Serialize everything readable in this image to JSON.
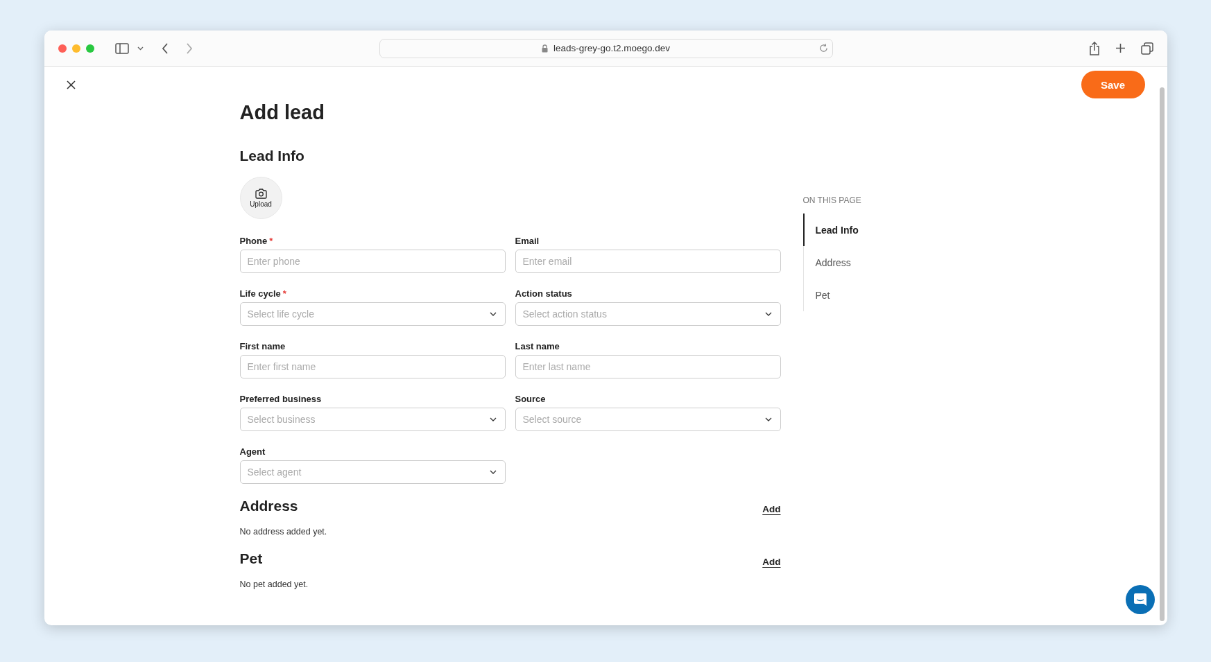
{
  "browser": {
    "url": "leads-grey-go.t2.moego.dev"
  },
  "page": {
    "title": "Add lead",
    "save_label": "Save"
  },
  "lead_info": {
    "heading": "Lead Info",
    "upload_label": "Upload",
    "required_mark": "*",
    "fields": [
      {
        "kind": "input",
        "label": "Phone",
        "required": true,
        "placeholder": "Enter phone"
      },
      {
        "kind": "input",
        "label": "Email",
        "required": false,
        "placeholder": "Enter email"
      },
      {
        "kind": "select",
        "label": "Life cycle",
        "required": true,
        "placeholder": "Select life cycle"
      },
      {
        "kind": "select",
        "label": "Action status",
        "required": false,
        "placeholder": "Select action status"
      },
      {
        "kind": "input",
        "label": "First name",
        "required": false,
        "placeholder": "Enter first name"
      },
      {
        "kind": "input",
        "label": "Last name",
        "required": false,
        "placeholder": "Enter last name"
      },
      {
        "kind": "select",
        "label": "Preferred business",
        "required": false,
        "placeholder": "Select business"
      },
      {
        "kind": "select",
        "label": "Source",
        "required": false,
        "placeholder": "Select source"
      },
      {
        "kind": "select",
        "label": "Agent",
        "required": false,
        "placeholder": "Select agent"
      }
    ]
  },
  "sections": [
    {
      "heading": "Address",
      "action": "Add",
      "empty_text": "No address added yet."
    },
    {
      "heading": "Pet",
      "action": "Add",
      "empty_text": "No pet added yet."
    }
  ],
  "toc": {
    "heading": "ON THIS PAGE",
    "items": [
      {
        "label": "Lead Info",
        "selected": true
      },
      {
        "label": "Address",
        "selected": false
      },
      {
        "label": "Pet",
        "selected": false
      }
    ]
  }
}
